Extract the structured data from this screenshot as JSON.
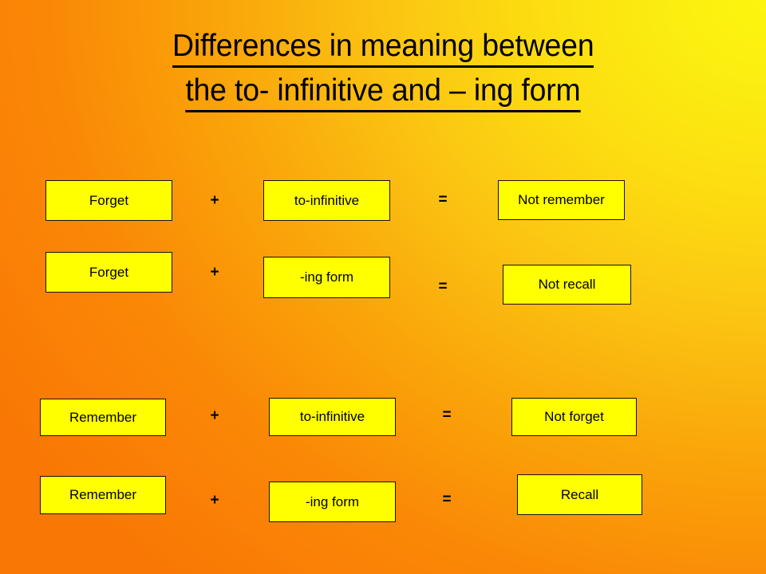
{
  "slide": {
    "title": {
      "line1": "Differences in meaning between",
      "line2": "the to- infinitive and – ing form"
    },
    "background": {
      "orange": "#FA7A05",
      "yellow": "#FCF60F"
    },
    "box_style": {
      "fill": "#FFFF00",
      "border": "#1A1008",
      "text": "#000000"
    },
    "operators": {
      "plus": "+",
      "equals": "="
    },
    "rows": [
      {
        "verb": "Forget",
        "operator1": "+",
        "form": "to-infinitive",
        "operator2": "=",
        "meaning": "Not remember"
      },
      {
        "verb": "Forget",
        "operator1": "+",
        "form": "-ing form",
        "operator2": "=",
        "meaning": "Not recall"
      },
      {
        "verb": "Remember",
        "operator1": "+",
        "form": "to-infinitive",
        "operator2": "=",
        "meaning": "Not forget"
      },
      {
        "verb": "Remember",
        "operator1": "+",
        "form": "-ing form",
        "operator2": "=",
        "meaning": "Recall"
      }
    ]
  }
}
